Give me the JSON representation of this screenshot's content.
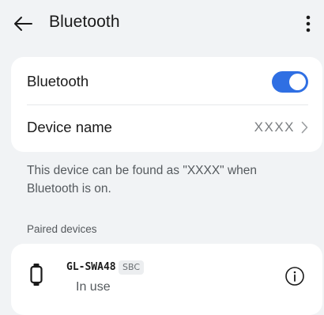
{
  "header": {
    "back_icon": "arrow-left-icon",
    "title": "Bluetooth",
    "more_icon": "more-vertical-icon"
  },
  "settings": {
    "bluetooth_label": "Bluetooth",
    "bluetooth_enabled": true,
    "device_name_label": "Device name",
    "device_name_value": "XXXX"
  },
  "description": "This device can be found as \"XXXX\" when Bluetooth is on.",
  "paired": {
    "section_label": "Paired devices",
    "devices": [
      {
        "name": "GL-SWA48",
        "codec": "SBC",
        "status": "In use",
        "icon": "smartwatch-icon"
      }
    ]
  },
  "colors": {
    "accent": "#2f6fe3",
    "background": "#f1f3f5",
    "card": "#ffffff"
  }
}
